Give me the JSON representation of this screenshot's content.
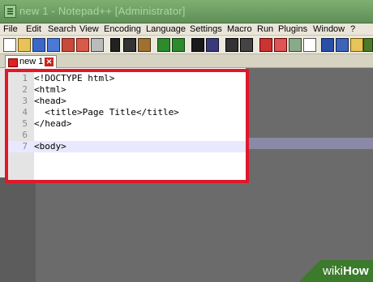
{
  "window": {
    "title": "new 1 - Notepad++ [Administrator]"
  },
  "menubar": {
    "items": [
      "File",
      "Edit",
      "Search",
      "View",
      "Encoding",
      "Language",
      "Settings",
      "Macro",
      "Run",
      "Plugins",
      "Window",
      "?"
    ]
  },
  "toolbar": {
    "icons": [
      "new-file-icon",
      "open-file-icon",
      "save-icon",
      "save-all-icon",
      "close-icon",
      "close-all-icon",
      "print-icon",
      "cut-icon",
      "copy-icon",
      "paste-icon",
      "undo-icon",
      "redo-icon",
      "find-icon",
      "replace-icon",
      "zoom-in-icon",
      "zoom-out-icon",
      "sync-vertical-icon",
      "sync-horizontal-icon",
      "word-wrap-icon",
      "all-chars-icon",
      "indent-guide-icon",
      "user-lang-icon",
      "doc-map-icon",
      "function-list-icon",
      "folder-workspace-icon"
    ]
  },
  "tabs": [
    {
      "label": "new 1"
    }
  ],
  "editor": {
    "lines": [
      {
        "num": "1",
        "text": "<!DOCTYPE html>"
      },
      {
        "num": "2",
        "text": "<html>"
      },
      {
        "num": "3",
        "text": "<head>"
      },
      {
        "num": "4",
        "text": "  <title>Page Title</title>"
      },
      {
        "num": "5",
        "text": "</head>"
      },
      {
        "num": "6",
        "text": ""
      },
      {
        "num": "7",
        "text": "<body>"
      }
    ],
    "current_line": "7"
  },
  "watermark": {
    "prefix": "wiki",
    "suffix": "How"
  },
  "colors": {
    "highlight_box": "#e0182a",
    "titlebar": "#6b9f63",
    "current_line": "#e8e8ff"
  }
}
